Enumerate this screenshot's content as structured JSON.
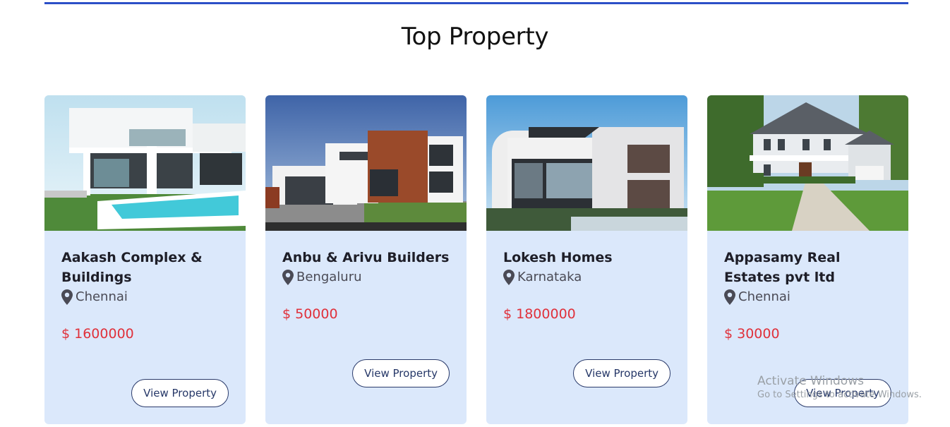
{
  "section": {
    "title": "Top Property"
  },
  "colors": {
    "accent": "#2c4fc7",
    "card_bg": "#dbe8fb",
    "price": "#e0303a",
    "button_border": "#2a3a6a"
  },
  "properties": [
    {
      "name": "Aakash Complex & Buildings",
      "location": "Chennai",
      "price": "$ 1600000",
      "button": "View Property",
      "image": "modern-villa-with-pool"
    },
    {
      "name": "Anbu & Arivu Builders",
      "location": "Bengaluru",
      "price": "$ 50000",
      "button": "View Property",
      "image": "modern-house-with-wood-panel"
    },
    {
      "name": "Lokesh Homes",
      "location": "Karnataka",
      "price": "$ 1800000",
      "button": "View Property",
      "image": "modern-house-with-glass-balconies"
    },
    {
      "name": "Appasamy Real Estates pvt ltd",
      "location": "Chennai",
      "price": "$ 30000",
      "button": "View Property",
      "image": "colonial-house-with-lawn"
    }
  ],
  "watermark": {
    "line1": "Activate Windows",
    "line2": "Go to Settings to activate Windows."
  }
}
